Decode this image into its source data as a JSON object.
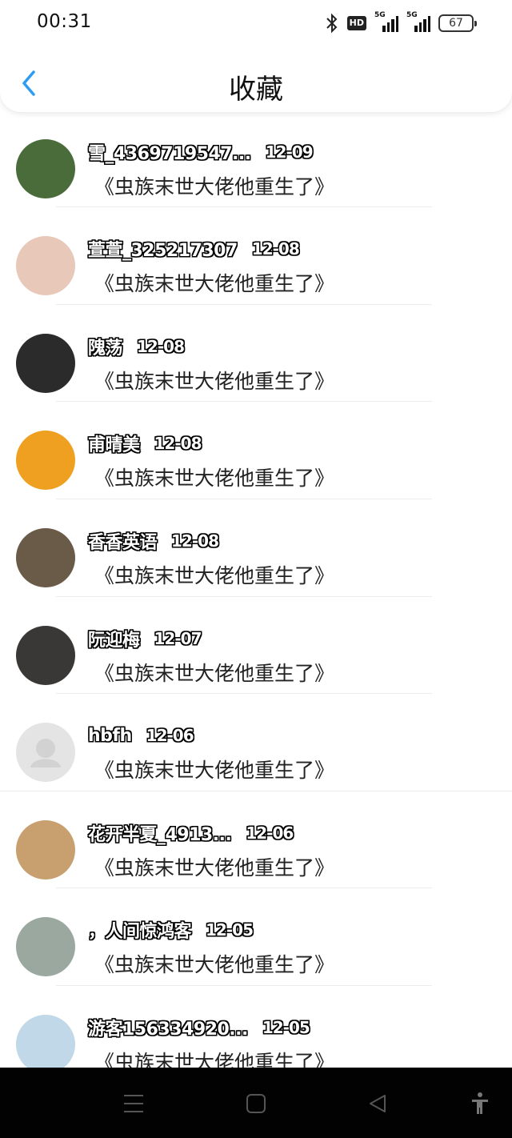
{
  "status_bar": {
    "time": "00:31",
    "hd_label": "HD",
    "signal1_label": "5G",
    "signal2_label": "5G",
    "battery": "67"
  },
  "header": {
    "title": "收藏",
    "back_icon": "chevron-left-icon"
  },
  "favorites": [
    {
      "name": "",
      "date": "",
      "book": "《虫族末世大佬他重生了》",
      "avatar_color": "#222222"
    },
    {
      "name": "雪_4369719547...",
      "date": "12-09",
      "book": "《虫族末世大佬他重生了》",
      "avatar_color": "#4a6b3a"
    },
    {
      "name": "萱萱_325217307",
      "date": "12-08",
      "book": "《虫族末世大佬他重生了》",
      "avatar_color": "#e8c8b8"
    },
    {
      "name": "隗荡",
      "date": "12-08",
      "book": "《虫族末世大佬他重生了》",
      "avatar_color": "#2b2b2b"
    },
    {
      "name": "甫晴美",
      "date": "12-08",
      "book": "《虫族末世大佬他重生了》",
      "avatar_color": "#f0a020"
    },
    {
      "name": "香香英语",
      "date": "12-08",
      "book": "《虫族末世大佬他重生了》",
      "avatar_color": "#6a5a48"
    },
    {
      "name": "阮迎梅",
      "date": "12-07",
      "book": "《虫族末世大佬他重生了》",
      "avatar_color": "#3a3836"
    },
    {
      "name": "hbfh",
      "date": "12-06",
      "book": "《虫族末世大佬他重生了》",
      "avatar_color": "#e4e4e4"
    },
    {
      "name": "花开半夏_4913...",
      "date": "12-06",
      "book": "《虫族末世大佬他重生了》",
      "avatar_color": "#c8a070"
    },
    {
      "name": "，人间惊鸿客",
      "date": "12-05",
      "book": "《虫族末世大佬他重生了》",
      "avatar_color": "#9aa8a0"
    },
    {
      "name": "游客156334920...",
      "date": "12-05",
      "book": "《虫族末世大佬他重生了》",
      "avatar_color": "#c0d8e8"
    }
  ],
  "nav_bar": {
    "menu_icon": "menu-icon",
    "home_icon": "square-home-icon",
    "back_icon": "triangle-back-icon",
    "accessibility_icon": "accessibility-icon"
  }
}
